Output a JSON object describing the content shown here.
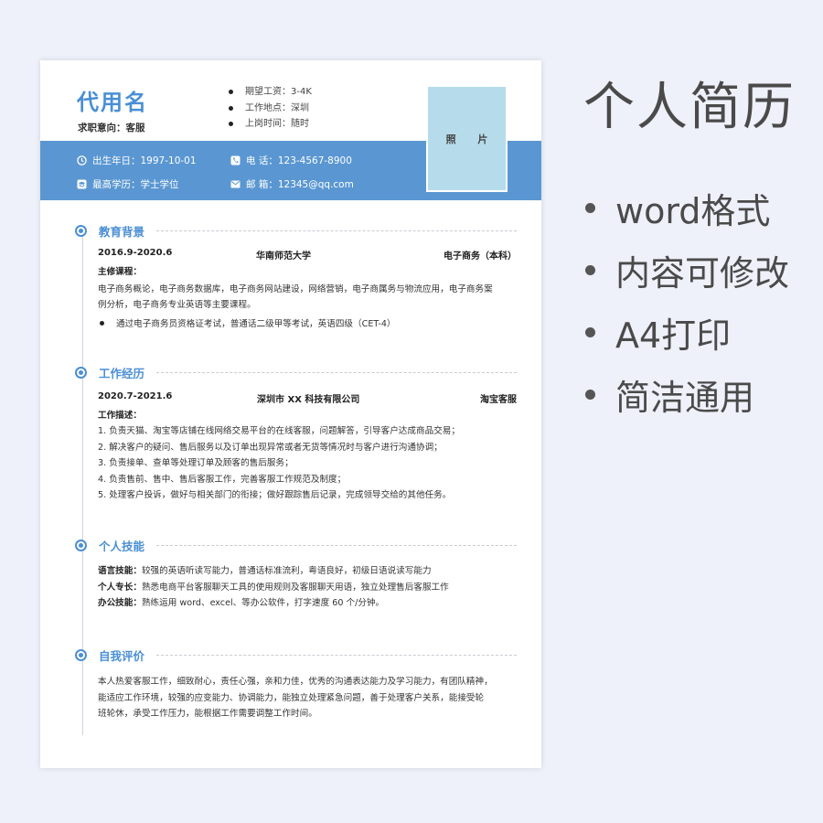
{
  "resume": {
    "name": "代用名",
    "intent": "求职意向：客服",
    "top_bullets": [
      "期望工资：3-4K",
      "工作地点：深圳",
      "上岗时间：随时"
    ],
    "photo_label": "照 片",
    "info": {
      "birth": "出生年日：1997-10-01",
      "phone": "电  话：123-4567-8900",
      "edu": "最高学历：学士学位",
      "email": "邮  箱：12345@qq.com"
    },
    "sections": {
      "education": {
        "title": "教育背景",
        "period": "2016.9-2020.6",
        "school": "华南师范大学",
        "major": "电子商务（本科）",
        "course_label": "主修课程：",
        "course_lines": [
          "电子商务概论，电子商务数据库，电子商务网站建设，网络营销，电子商属务与物流应用，电子商务案",
          "例分析，电子商务专业英语等主要课程。"
        ],
        "cert": "通过电子商务员资格证考试，普通话二级甲等考试，英语四级（CET-4）"
      },
      "work": {
        "title": "工作经历",
        "period": "2020.7-2021.6",
        "company": "深圳市 XX 科技有限公司",
        "role": "淘宝客服",
        "desc_label": "工作描述：",
        "items": [
          "1.    负责天猫、淘宝等店铺在线网络交易平台的在线客服，问题解答，引导客户达成商品交易；",
          "2.    解决客户的疑问、售后服务以及订单出现异常或者无货等情况时与客户进行沟通协调；",
          "3.    负责接单、查单等处理订单及顾客的售后服务；",
          "4.    负责售前、售中、售后客服工作，完善客服工作规范及制度；",
          "5.    处理客户投诉，做好与相关部门的衔接；做好跟踪售后记录，完成领导交给的其他任务。"
        ]
      },
      "skills": {
        "title": "个人技能",
        "rows": [
          {
            "label": "语言技能：",
            "text": "较强的英语听读写能力，普通话标准流利，粤语良好，初级日语说读写能力"
          },
          {
            "label": "个人专长：",
            "text": "熟悉电商平台客服聊天工具的使用规则及客服聊天用语，独立处理售后客服工作"
          },
          {
            "label": "办公技能：",
            "text": "熟练运用 word、excel、等办公软件，打字速度 60 个/分钟。"
          }
        ]
      },
      "self": {
        "title": "自我评价",
        "lines": [
          "本人热爱客服工作，细致耐心，责任心强，亲和力佳，优秀的沟通表达能力及学习能力，有团队精神，",
          "能适应工作环境，较强的应变能力、协调能力，能独立处理紧急问题，善于处理客户关系，能接受轮",
          "班轮休，承受工作压力，能根据工作需要调整工作时间。"
        ]
      }
    }
  },
  "promo": {
    "title": "个人简历",
    "features": [
      "word格式",
      "内容可修改",
      "A4打印",
      "简洁通用"
    ]
  },
  "colors": {
    "accent": "#4a8fd4",
    "band": "#5a97d2",
    "photo": "#b6dceb",
    "background": "#eef0fa"
  },
  "icons": [
    "clock-icon",
    "phone-icon",
    "graduation-icon",
    "mail-icon"
  ]
}
